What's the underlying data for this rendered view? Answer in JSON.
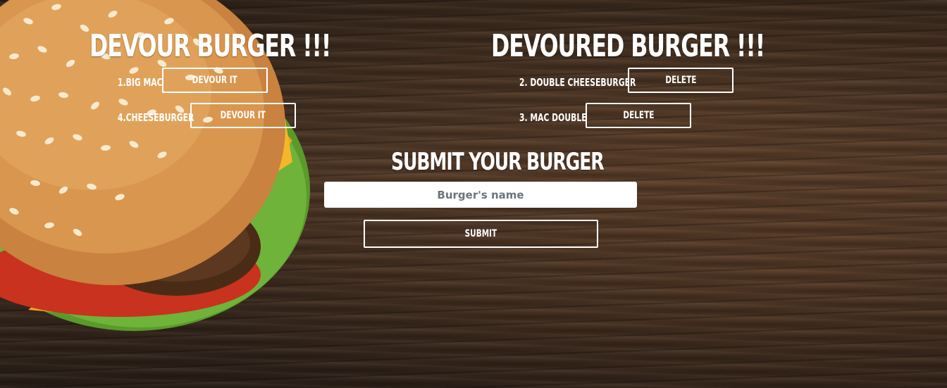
{
  "colors": {
    "text": "#ffffff",
    "button_border": "#ffffff",
    "input_bg": "#ffffff",
    "placeholder": "#6b747c"
  },
  "devour_section": {
    "title": "DEVOUR BURGER !!!",
    "items": [
      {
        "label": "1.BIG MAC",
        "button": "DEVOUR IT"
      },
      {
        "label": "4.CHEESEBURGER",
        "button": "DEVOUR IT"
      }
    ]
  },
  "devoured_section": {
    "title": "DEVOURED BURGER !!!",
    "items": [
      {
        "label": "2. DOUBLE CHEESEBURGER",
        "button": "DELETE"
      },
      {
        "label": "3. MAC DOUBLE",
        "button": "DELETE"
      }
    ]
  },
  "submit_section": {
    "title": "SUBMIT YOUR BURGER",
    "input_placeholder": "Burger's name",
    "input_value": "",
    "submit_label": "SUBMIT"
  }
}
